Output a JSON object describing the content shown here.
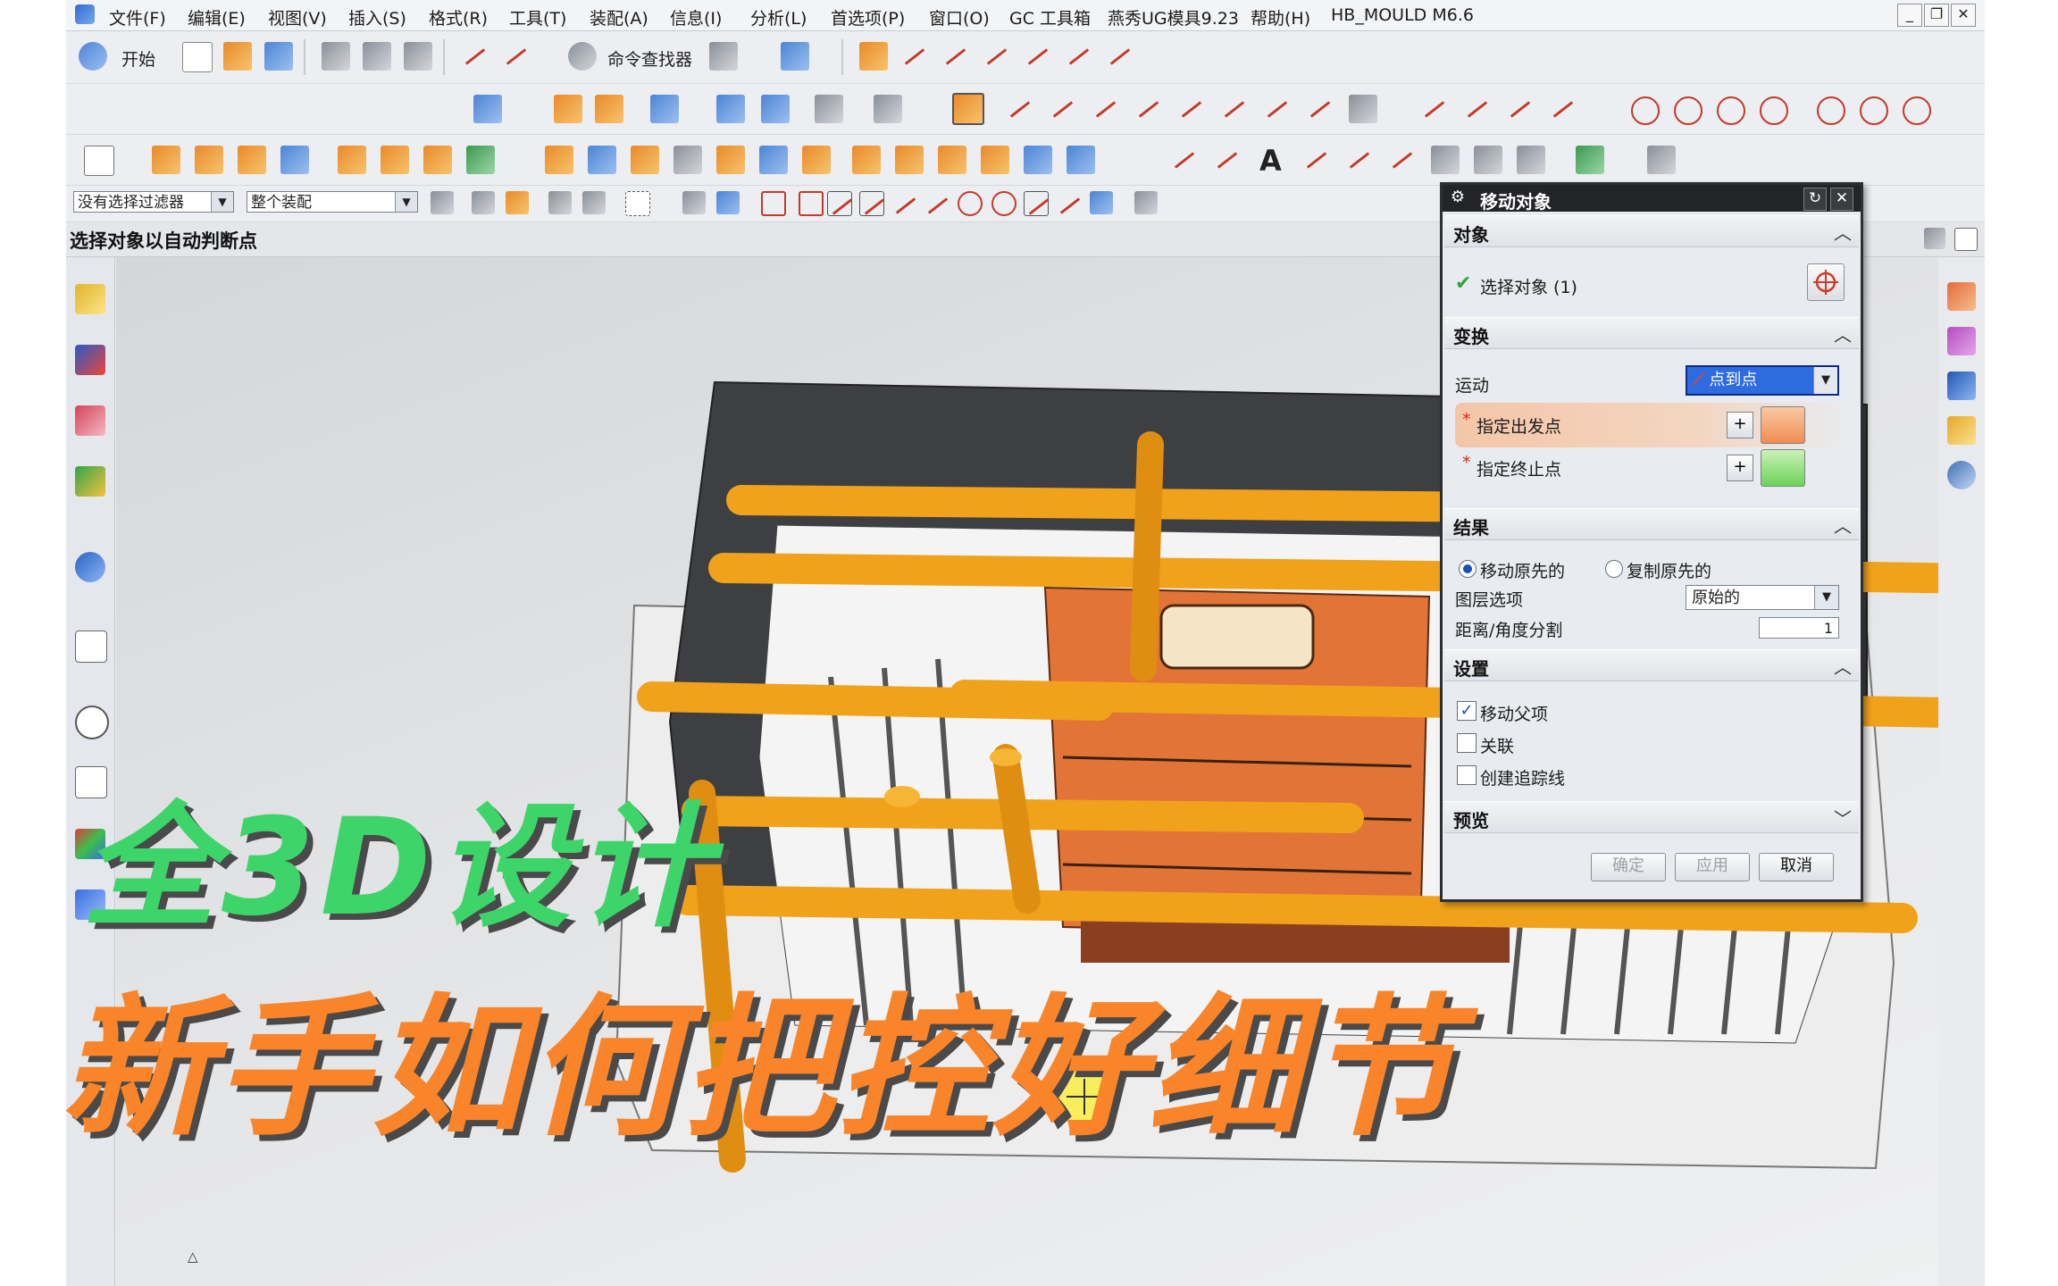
{
  "menubar": {
    "items": [
      "文件(F)",
      "编辑(E)",
      "视图(V)",
      "插入(S)",
      "格式(R)",
      "工具(T)",
      "装配(A)",
      "信息(I)",
      "分析(L)",
      "首选项(P)",
      "窗口(O)",
      "GC 工具箱",
      "燕秀UG模具9.23",
      "帮助(H)",
      "HB_MOULD M6.6"
    ]
  },
  "toolbar": {
    "start_label": "开始",
    "command_finder_label": "命令查找器",
    "filter_select": "没有选择过滤器",
    "assembly_select": "整个装配"
  },
  "status": {
    "prompt": "选择对象以自动判断点"
  },
  "dialog": {
    "title": "移动对象",
    "sections": {
      "object": "对象",
      "transform": "变换",
      "result": "结果",
      "settings": "设置",
      "preview": "预览"
    },
    "select_object_label": "选择对象 (1)",
    "motion_label": "运动",
    "motion_value": "点到点",
    "from_point_label": "指定出发点",
    "to_point_label": "指定终止点",
    "move_original_label": "移动原先的",
    "copy_original_label": "复制原先的",
    "result_mode": "移动原先的",
    "layer_option_label": "图层选项",
    "layer_option_value": "原始的",
    "distance_split_label": "距离/角度分割",
    "distance_split_value": "1",
    "move_parent_label": "移动父项",
    "move_parent_checked": true,
    "associative_label": "关联",
    "associative_checked": false,
    "trace_label": "创建追踪线",
    "trace_checked": false,
    "ok_label": "确定",
    "apply_label": "应用",
    "cancel_label": "取消"
  },
  "overlay": {
    "line1": "全3D设计",
    "line2": "新手如何把控好细节"
  },
  "colors": {
    "overlay_green": "#3dd56a",
    "overlay_orange": "#f98429",
    "pipe_orange": "#f0a21b",
    "part_orange": "#e27437",
    "dialog_title": "#232427",
    "motion_selected": "#2e6ae0"
  },
  "icons": {
    "dialog": [
      "gear-icon",
      "reset-icon",
      "close-icon",
      "crosshair-icon",
      "check-icon",
      "point-constructor-icon",
      "inferred-point-icon"
    ],
    "window": [
      "minimize-icon",
      "restore-icon",
      "close-icon"
    ]
  }
}
